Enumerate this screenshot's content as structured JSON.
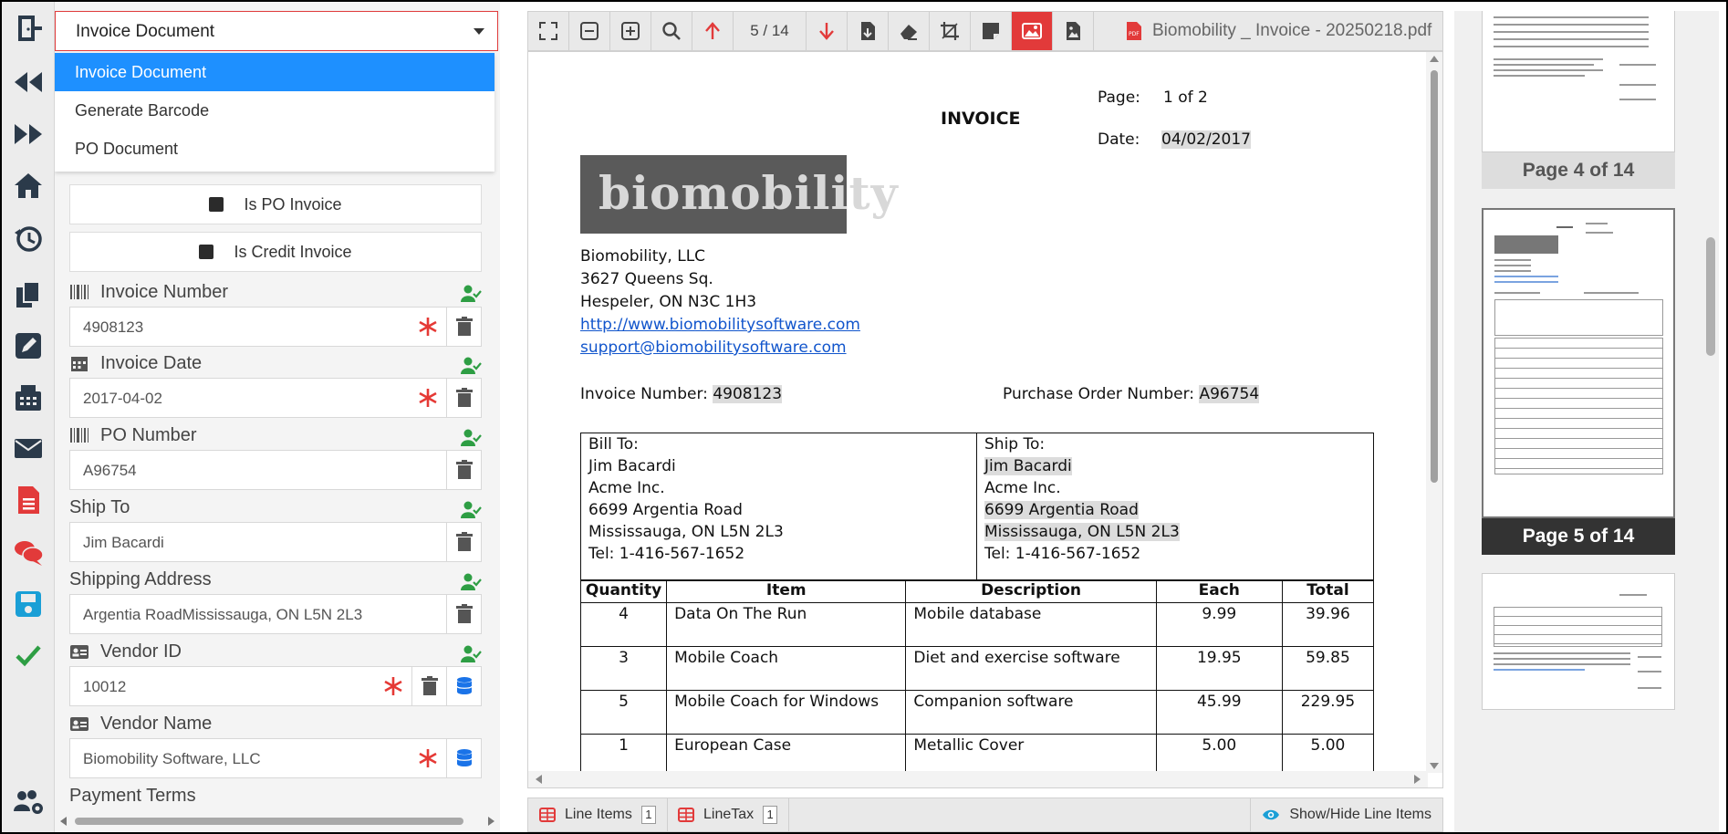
{
  "form": {
    "document_type": "Invoice Document",
    "menu": [
      "Invoice Document",
      "Generate Barcode",
      "PO Document"
    ],
    "checkbox_po": "Is PO Invoice",
    "checkbox_credit": "Is Credit Invoice",
    "fields": {
      "invoice_number": {
        "label": "Invoice Number",
        "value": "4908123"
      },
      "invoice_date": {
        "label": "Invoice Date",
        "value": "2017-04-02"
      },
      "po_number": {
        "label": "PO Number",
        "value": "A96754"
      },
      "ship_to": {
        "label": "Ship To",
        "value": "Jim Bacardi"
      },
      "shipping_address": {
        "label": "Shipping Address",
        "value": "Argentia RoadMississauga, ON L5N 2L3"
      },
      "vendor_id": {
        "label": "Vendor ID",
        "value": "10012"
      },
      "vendor_name": {
        "label": "Vendor Name",
        "value": "Biomobility Software, LLC"
      },
      "payment_terms": {
        "label": "Payment Terms"
      }
    }
  },
  "viewer": {
    "page_indicator": "5 / 14",
    "file_name": "Biomobility _ Invoice - 20250218.pdf",
    "document": {
      "title": "INVOICE",
      "page_label": "Page:",
      "page_value": "1 of 2",
      "date_label": "Date:",
      "date_value": "04/02/2017",
      "logo_text": "biomobility",
      "company": "Biomobility, LLC",
      "street": "3627 Queens Sq.",
      "city": "Hespeler, ON N3C 1H3",
      "website": "http://www.biomobilitysoftware.com",
      "email": "support@biomobilitysoftware.com",
      "invoice_number_label": "Invoice Number:",
      "invoice_number_value": "4908123",
      "po_label": "Purchase Order Number:",
      "po_value": "A96754",
      "bill_to": {
        "heading": "Bill To:",
        "name": "Jim Bacardi",
        "company": "Acme Inc.",
        "street": "6699 Argentia Road",
        "city": "Mississauga, ON L5N 2L3",
        "tel": "Tel: 1-416-567-1652"
      },
      "ship_to": {
        "heading": "Ship To:",
        "name": "Jim Bacardi",
        "company": "Acme Inc.",
        "street": "6699 Argentia Road",
        "city": "Mississauga, ON L5N 2L3",
        "tel": "Tel: 1-416-567-1652"
      },
      "table_headers": [
        "Quantity",
        "Item",
        "Description",
        "Each",
        "Total"
      ],
      "rows": [
        [
          "4",
          "Data On The Run",
          "Mobile database",
          "9.99",
          "39.96"
        ],
        [
          "3",
          "Mobile Coach",
          "Diet and exercise software",
          "19.95",
          "59.85"
        ],
        [
          "5",
          "Mobile Coach for Windows",
          "Companion software",
          "45.99",
          "229.95"
        ],
        [
          "1",
          "European Case",
          "Metallic Cover",
          "5.00",
          "5.00"
        ]
      ]
    },
    "tabs": [
      {
        "label": "Line Items",
        "count": "1"
      },
      {
        "label": "LineTax",
        "count": "1"
      }
    ],
    "show_hide": "Show/Hide Line Items"
  },
  "thumbnails": {
    "page4": "Page 4 of 14",
    "page5": "Page 5 of 14"
  },
  "colors": {
    "accent": "#1e90ff",
    "required": "#e53935",
    "success": "#2e9e44",
    "danger_button": "#e23a3a",
    "db_blue": "#1a73e8"
  }
}
